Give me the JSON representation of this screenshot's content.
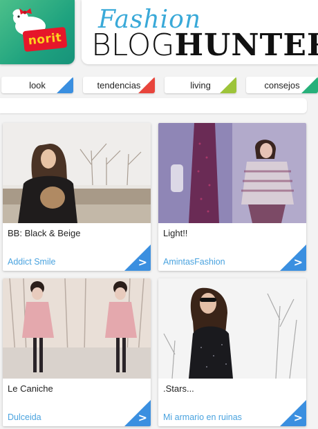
{
  "brand": {
    "logo_text": "norit",
    "script_title": "Fashion",
    "main_thin": "BLOG",
    "main_bold": "HUNTER"
  },
  "tabs": [
    {
      "label": "look",
      "color": "#3a8fe0"
    },
    {
      "label": "tendencias",
      "color": "#e8453c"
    },
    {
      "label": "living",
      "color": "#9dc43a"
    },
    {
      "label": "consejos",
      "color": "#27b07a"
    }
  ],
  "posts": [
    {
      "title": "BB: Black & Beige",
      "author": "Addict Smile",
      "arrow": ">"
    },
    {
      "title": "Light!!",
      "author": "AmintasFashion",
      "arrow": ">"
    },
    {
      "title": "Le Caniche",
      "author": "Dulceida",
      "arrow": ">"
    },
    {
      "title": ".Stars...",
      "author": "Mi armario en ruinas",
      "arrow": ">"
    }
  ]
}
